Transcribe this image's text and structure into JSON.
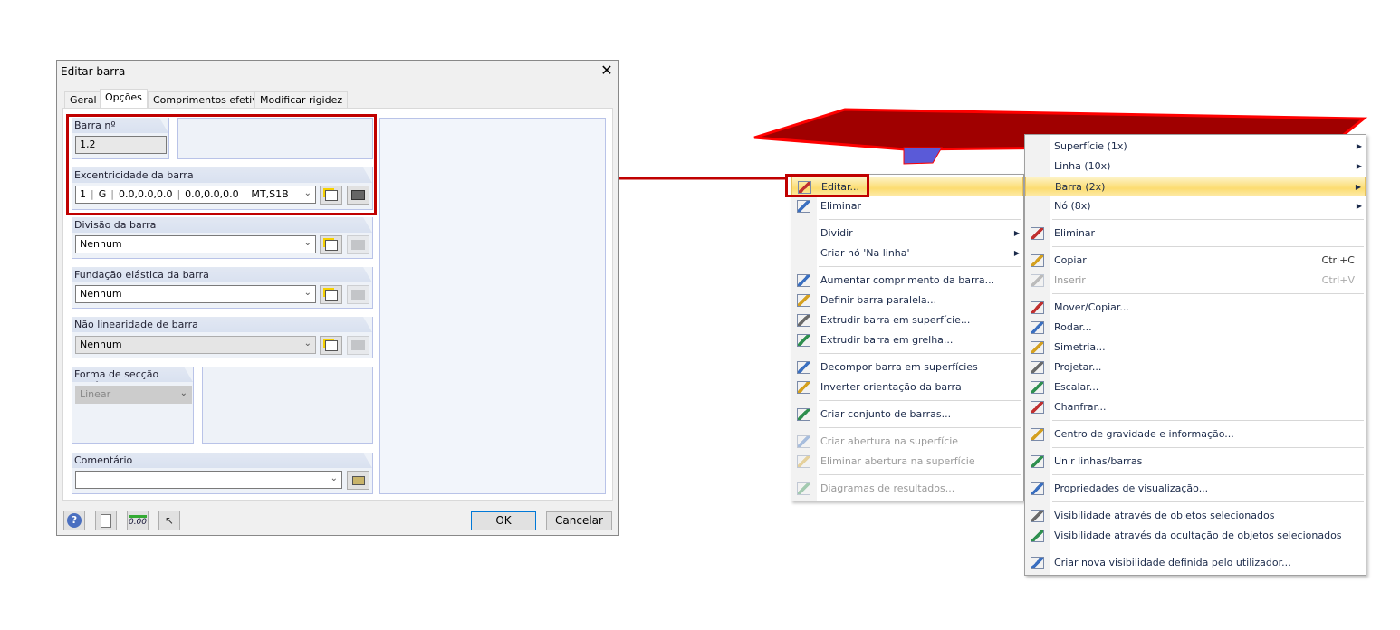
{
  "dialog": {
    "title": "Editar barra",
    "close": "✕",
    "tabs": [
      "Geral",
      "Opções",
      "Comprimentos efetivos",
      "Modificar rigidez"
    ],
    "active_tab": "Opções",
    "member_no": {
      "label": "Barra nº",
      "value": "1,2"
    },
    "eccentricity": {
      "label": "Excentricidade da barra",
      "parts": [
        "1",
        "G",
        "0.0,0.0,0.0",
        "0.0,0.0,0.0",
        "MT,S1B"
      ]
    },
    "division": {
      "label": "Divisão da barra",
      "value": "Nenhum"
    },
    "foundation": {
      "label": "Fundação elástica da barra",
      "value": "Nenhum"
    },
    "nonlinearity": {
      "label": "Não linearidade de barra",
      "value": "Nenhum"
    },
    "variable_section": {
      "label": "Forma de secção variável",
      "value": "Linear"
    },
    "comment": {
      "label": "Comentário",
      "value": ""
    },
    "buttons": {
      "ok": "OK",
      "cancel": "Cancelar"
    },
    "highlight_color": "#c00000"
  },
  "menu1": [
    {
      "label": "Editar...",
      "icon": "edit-member-icon",
      "highlight": true
    },
    {
      "label": "Eliminar",
      "icon": "delete-member-icon"
    },
    {
      "sep": true
    },
    {
      "label": "Dividir",
      "submenu": true
    },
    {
      "label": "Criar nó 'Na linha'",
      "submenu": true
    },
    {
      "sep": true
    },
    {
      "label": "Aumentar comprimento da barra...",
      "icon": "extend-member-icon"
    },
    {
      "label": "Definir barra paralela...",
      "icon": "parallel-member-icon"
    },
    {
      "label": "Extrudir barra em superfície...",
      "icon": "extrude-surface-icon"
    },
    {
      "label": "Extrudir barra em grelha...",
      "icon": "extrude-grid-icon"
    },
    {
      "sep": true
    },
    {
      "label": "Decompor barra em superfícies",
      "icon": "decompose-icon"
    },
    {
      "label": "Inverter orientação da barra",
      "icon": "reverse-icon"
    },
    {
      "sep": true
    },
    {
      "label": "Criar conjunto de barras...",
      "icon": "member-set-icon"
    },
    {
      "sep": true
    },
    {
      "label": "Criar abertura na superfície",
      "icon": "create-opening-icon",
      "disabled": true
    },
    {
      "label": "Eliminar abertura na superfície",
      "icon": "delete-opening-icon",
      "disabled": true
    },
    {
      "sep": true
    },
    {
      "label": "Diagramas de resultados...",
      "icon": "result-diagram-icon",
      "disabled": true
    }
  ],
  "menu2": [
    {
      "label": "Superfície (1x)",
      "submenu": true
    },
    {
      "label": "Linha (10x)",
      "submenu": true
    },
    {
      "label": "Barra (2x)",
      "submenu": true,
      "highlight": true
    },
    {
      "label": "Nó (8x)",
      "submenu": true
    },
    {
      "sep": true
    },
    {
      "label": "Eliminar",
      "icon": "delete-icon"
    },
    {
      "sep": true
    },
    {
      "label": "Copiar",
      "icon": "copy-icon",
      "shortcut": "Ctrl+C"
    },
    {
      "label": "Inserir",
      "icon": "paste-icon",
      "shortcut": "Ctrl+V",
      "disabled": true
    },
    {
      "sep": true
    },
    {
      "label": "Mover/Copiar...",
      "icon": "move-icon"
    },
    {
      "label": "Rodar...",
      "icon": "rotate-icon"
    },
    {
      "label": "Simetria...",
      "icon": "mirror-icon"
    },
    {
      "label": "Projetar...",
      "icon": "project-icon"
    },
    {
      "label": "Escalar...",
      "icon": "scale-icon"
    },
    {
      "label": "Chanfrar...",
      "icon": "chamfer-icon"
    },
    {
      "sep": true
    },
    {
      "label": "Centro de gravidade e informação...",
      "icon": "center-of-gravity-icon"
    },
    {
      "sep": true
    },
    {
      "label": "Unir linhas/barras",
      "icon": "join-icon"
    },
    {
      "sep": true
    },
    {
      "label": "Propriedades de visualização...",
      "icon": "display-properties-icon"
    },
    {
      "sep": true
    },
    {
      "label": "Visibilidade através de objetos selecionados",
      "icon": "visibility-icon"
    },
    {
      "label": "Visibilidade através da ocultação de objetos selecionados",
      "icon": "visibility-hide-icon"
    },
    {
      "sep": true
    },
    {
      "label": "Criar nova visibilidade definida pelo utilizador...",
      "icon": "new-visibility-icon"
    }
  ]
}
